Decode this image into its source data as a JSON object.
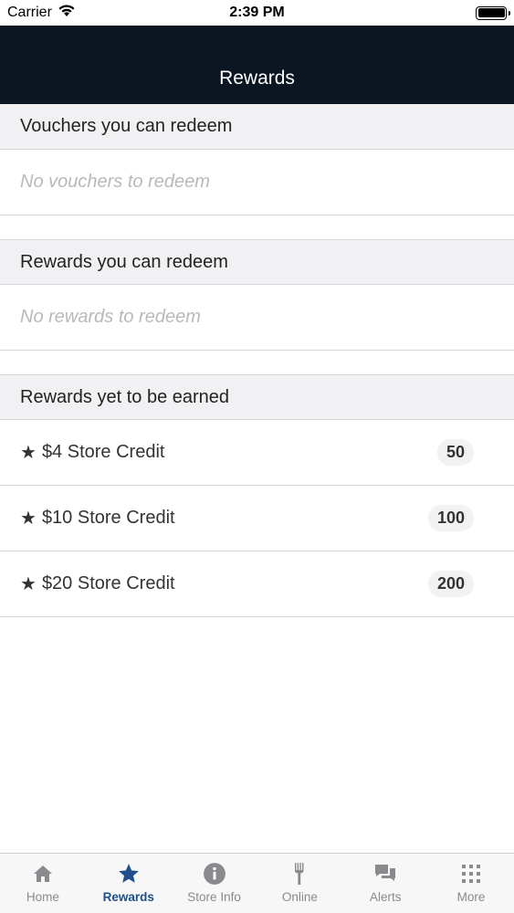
{
  "status_bar": {
    "carrier": "Carrier",
    "time": "2:39 PM"
  },
  "nav": {
    "title": "Rewards"
  },
  "sections": {
    "vouchers": {
      "header": "Vouchers you can redeem",
      "empty_text": "No vouchers to redeem"
    },
    "rewards_redeem": {
      "header": "Rewards you can redeem",
      "empty_text": "No rewards to redeem"
    },
    "rewards_earn": {
      "header": "Rewards yet to be earned",
      "items": [
        {
          "star": "★",
          "label": "$4 Store Credit",
          "points": "50"
        },
        {
          "star": "★",
          "label": "$10 Store Credit",
          "points": "100"
        },
        {
          "star": "★",
          "label": "$20 Store Credit",
          "points": "200"
        }
      ]
    }
  },
  "tabs": [
    {
      "label": "Home",
      "icon": "home-icon",
      "active": false
    },
    {
      "label": "Rewards",
      "icon": "star-icon",
      "active": true
    },
    {
      "label": "Store Info",
      "icon": "info-icon",
      "active": false
    },
    {
      "label": "Online",
      "icon": "fork-icon",
      "active": false
    },
    {
      "label": "Alerts",
      "icon": "chat-bubbles-icon",
      "active": false
    },
    {
      "label": "More",
      "icon": "grid-icon",
      "active": false
    }
  ],
  "colors": {
    "nav_background": "#0b1622",
    "tab_active": "#1f4e8a",
    "tab_inactive": "#8a8a8e"
  }
}
